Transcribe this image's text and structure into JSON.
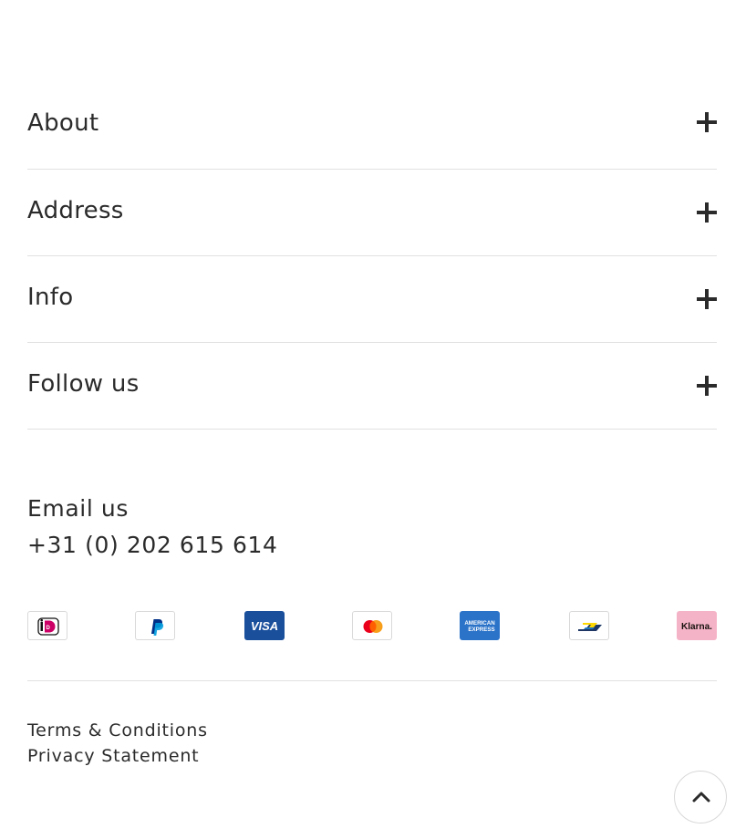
{
  "footer": {
    "sections": [
      {
        "label": "About",
        "icon": "plus-icon"
      },
      {
        "label": "Address",
        "icon": "plus-icon"
      },
      {
        "label": "Info",
        "icon": "plus-icon"
      },
      {
        "label": "Follow us",
        "icon": "plus-icon"
      }
    ],
    "contact": {
      "email_label": "Email us",
      "phone": "+31 (0) 202 615 614"
    },
    "payment_methods": [
      {
        "name": "iDEAL",
        "icon": "ideal-icon"
      },
      {
        "name": "PayPal",
        "icon": "paypal-icon"
      },
      {
        "name": "VISA",
        "icon": "visa-icon"
      },
      {
        "name": "Mastercard",
        "icon": "mastercard-icon"
      },
      {
        "name": "American Express",
        "icon": "amex-icon",
        "line1": "AMERICAN",
        "line2": "EXPRESS"
      },
      {
        "name": "Bancontact",
        "icon": "bancontact-icon"
      },
      {
        "name": "Klarna",
        "icon": "klarna-icon",
        "text": "Klarna."
      }
    ],
    "legal": {
      "terms": "Terms & Conditions",
      "privacy": "Privacy Statement"
    },
    "back_to_top": {
      "icon": "chevron-up-icon"
    }
  },
  "colors": {
    "text": "#2b2b2b",
    "divider": "#e1e1e1",
    "visa": "#1a4f9c",
    "amex": "#2b73c9",
    "klarna": "#f5b3c7",
    "ideal": "#cc0066",
    "paypal_dark": "#003087",
    "paypal_light": "#009cde",
    "mastercard_red": "#eb001b",
    "mastercard_orange": "#f79e1b",
    "bancontact_blue": "#1e3764",
    "bancontact_yellow": "#ffd800"
  }
}
